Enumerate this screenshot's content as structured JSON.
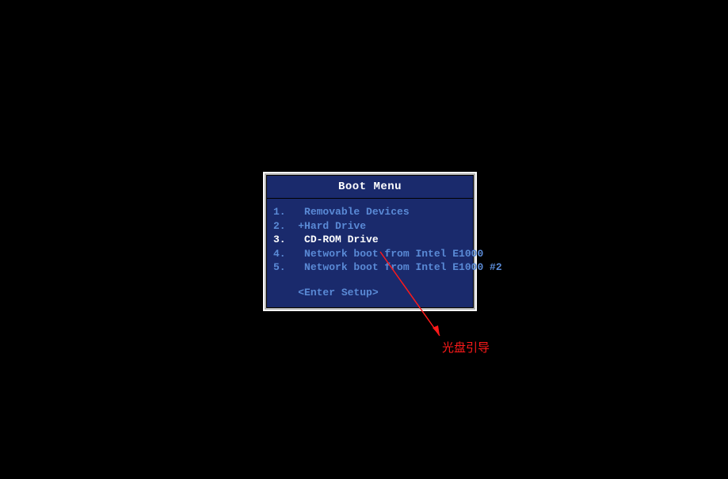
{
  "menu": {
    "title": "Boot Menu",
    "items": [
      {
        "num": "1.",
        "label": "Removable Devices",
        "selected": false
      },
      {
        "num": "2.",
        "label": "+Hard Drive",
        "selected": false
      },
      {
        "num": "3.",
        "label": "CD-ROM Drive",
        "selected": true
      },
      {
        "num": "4.",
        "label": "Network boot from Intel E1000",
        "selected": false
      },
      {
        "num": "5.",
        "label": "Network boot from Intel E1000 #2",
        "selected": false
      }
    ],
    "enter_setup": "<Enter Setup>"
  },
  "annotation": {
    "label": "光盘引导"
  }
}
